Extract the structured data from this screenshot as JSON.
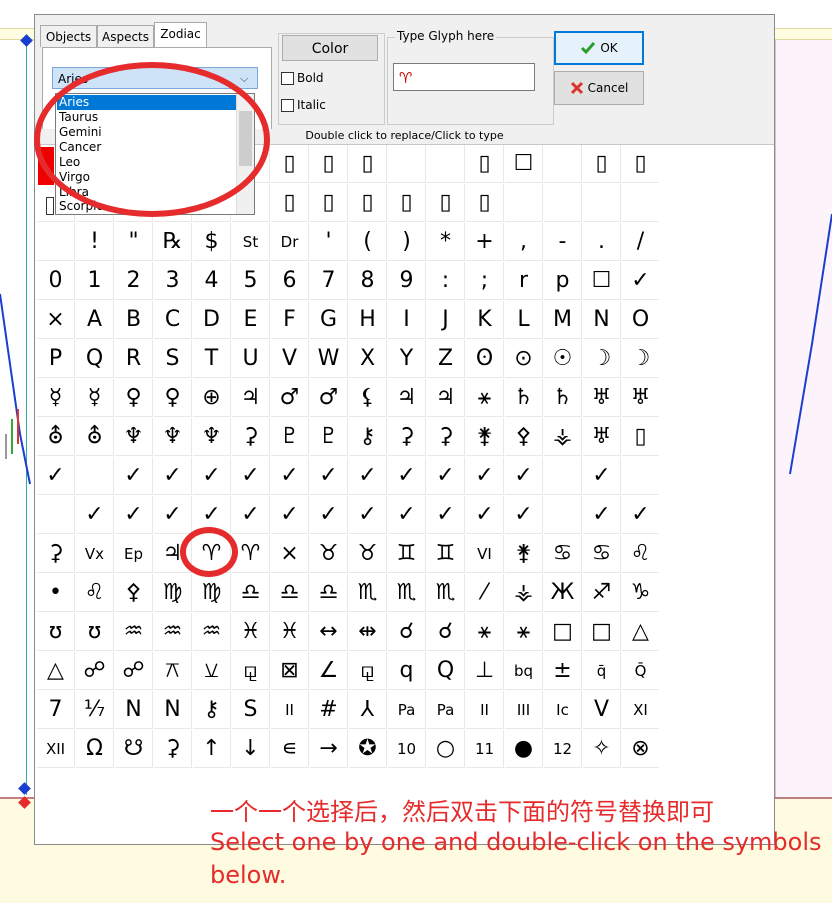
{
  "tabs": [
    {
      "label": "Objects"
    },
    {
      "label": "Aspects"
    },
    {
      "label": "Zodiac"
    }
  ],
  "zodiac_combo": {
    "value": "Aries",
    "arrow": "⌵"
  },
  "sign_list": [
    "Aries",
    "Taurus",
    "Gemini",
    "Cancer",
    "Leo",
    "Virgo",
    "Libra",
    "Scorpio"
  ],
  "color_button": "Color",
  "bold_label": "Bold",
  "italic_label": "Italic",
  "glyph_group_label": "Type Glyph here",
  "glyph_input_value": "♈",
  "ok_label": "OK",
  "cancel_label": "Cancel",
  "hint_text": "Double click to replace/Click to type",
  "grid_rows": [
    [
      "",
      "",
      "",
      "",
      "",
      "",
      "▯",
      "▯",
      "▯",
      "",
      "",
      "▯",
      "☐",
      "",
      "▯",
      "▯"
    ],
    [
      "",
      "",
      "",
      "",
      "",
      "",
      "▯",
      "▯",
      "▯",
      "▯",
      "▯",
      "▯",
      "",
      "",
      "",
      ""
    ],
    [
      "",
      "!",
      "\"",
      "℞",
      "$",
      "St",
      "Dr",
      "'",
      "(",
      ")",
      "*",
      "+",
      ",",
      "-",
      ".",
      "/"
    ],
    [
      "0",
      "1",
      "2",
      "3",
      "4",
      "5",
      "6",
      "7",
      "8",
      "9",
      ":",
      ";",
      "r",
      "p",
      "☐",
      "✓"
    ],
    [
      "×",
      "A",
      "B",
      "C",
      "D",
      "E",
      "F",
      "G",
      "H",
      "I",
      "J",
      "K",
      "L",
      "M",
      "N",
      "O"
    ],
    [
      "P",
      "Q",
      "R",
      "S",
      "T",
      "U",
      "V",
      "W",
      "X",
      "Y",
      "Z",
      "ʘ",
      "⊙",
      "☉",
      "☽",
      "☽"
    ],
    [
      "☿",
      "☿",
      "♀",
      "♀",
      "⊕",
      "♃",
      "♂",
      "♂",
      "⚸",
      "♃",
      "♃",
      "⚹",
      "♄",
      "♄",
      "♅",
      "♅"
    ],
    [
      "⛢",
      "⛢",
      "♆",
      "♆",
      "♆",
      "⚳",
      "♇",
      "♇",
      "⚷",
      "⚳",
      "⚳",
      "⚵",
      "⚴",
      "⚶",
      "♅",
      "▯"
    ],
    [
      "✓",
      "",
      "✓",
      "✓",
      "✓",
      "✓",
      "✓",
      "✓",
      "✓",
      "✓",
      "✓",
      "✓",
      "✓",
      "",
      "✓",
      ""
    ],
    [
      "",
      "✓",
      "✓",
      "✓",
      "✓",
      "✓",
      "✓",
      "✓",
      "✓",
      "✓",
      "✓",
      "✓",
      "✓",
      "",
      "✓",
      "✓"
    ],
    [
      "⚳",
      "Vx",
      "Ep",
      "♃",
      "♈",
      "♈",
      "×",
      "♉",
      "♉",
      "♊",
      "♊",
      "VI",
      "⚵",
      "♋",
      "♋",
      "♌"
    ],
    [
      "•",
      "♌",
      "⚴",
      "♍",
      "♍",
      "♎",
      "♎",
      "♎",
      "♏",
      "♏",
      "♏",
      "⁄",
      "⚶",
      "Ж",
      "♐",
      "♑"
    ],
    [
      "ʊ",
      "ʊ",
      "♒",
      "♒",
      "♒",
      "♓",
      "♓",
      "↔",
      "⇹",
      "☌",
      "☌",
      "⚹",
      "⚹",
      "□",
      "□",
      "△"
    ],
    [
      "△",
      "☍",
      "☍",
      "⚻",
      "⚺",
      "⚼",
      "⊠",
      "∠",
      "⚼",
      "q",
      "Q",
      "⊥",
      "bq",
      "±",
      "q̄",
      "Q̄"
    ],
    [
      "7",
      "⅐",
      "N",
      "N",
      "⚷",
      "S",
      "II",
      "#",
      "⅄",
      "Pa",
      "Pa",
      "II",
      "III",
      "Ic",
      "V",
      "XI"
    ],
    [
      "XII",
      "Ω",
      "☋",
      "⚳",
      "↑",
      "↓",
      "∊",
      "→",
      "✪",
      "10",
      "○",
      "11",
      "●",
      "12",
      "✧",
      "⊗"
    ]
  ],
  "annotation_cn": "一个一个选择后，然后双击下面的符号替换即可",
  "annotation_en_1": "Select one by one and double-click on the symbols",
  "annotation_en_2": "below."
}
